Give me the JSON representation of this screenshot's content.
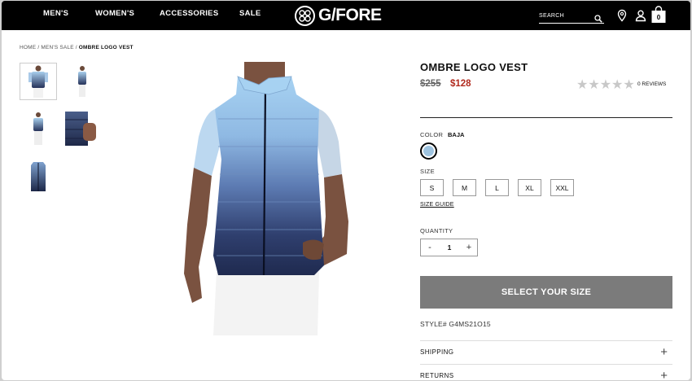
{
  "nav": {
    "items": [
      "MEN'S",
      "WOMEN'S",
      "ACCESSORIES",
      "SALE"
    ],
    "logo_text": "G/FORE",
    "search_placeholder": "SEARCH",
    "bag_count": "0"
  },
  "breadcrumb": {
    "home": "HOME",
    "category": "MEN'S SALE",
    "current": "OMBRE LOGO VEST",
    "separator": "/"
  },
  "product": {
    "title": "OMBRE LOGO VEST",
    "price_original": "$255",
    "price_sale": "$128",
    "rating_stars": 0,
    "reviews_label": "0 REVIEWS",
    "color_label": "COLOR",
    "color_value": "BAJA",
    "size_label": "SIZE",
    "sizes": [
      "S",
      "M",
      "L",
      "XL",
      "XXL"
    ],
    "size_guide": "SIZE GUIDE",
    "quantity_label": "QUANTITY",
    "quantity_minus": "-",
    "quantity_value": "1",
    "quantity_plus": "+",
    "cta_label": "SELECT YOUR SIZE",
    "style_number": "STYLE# G4MS21O15",
    "accordion": [
      "SHIPPING",
      "RETURNS"
    ]
  },
  "icons": {
    "search": "search-icon",
    "location": "location-pin-icon",
    "account": "user-icon",
    "bag": "shopping-bag-icon",
    "accordion_toggle": "plus-icon"
  },
  "colors": {
    "topbar": "#000000",
    "sale_price": "#b12a1e",
    "cta_background": "#7b7b7b",
    "swatch_baja": "#9fc4e0",
    "star_empty": "#c8c8c8"
  }
}
